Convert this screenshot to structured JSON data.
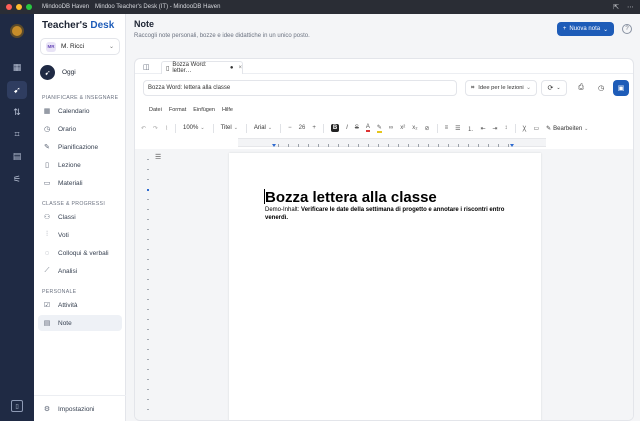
{
  "window": {
    "app_title": "MindooDB Haven",
    "title": "Mindoo Teacher's Desk (IT) - MindooDB Haven",
    "traffic_colors": [
      "#ff5f57",
      "#febc2e",
      "#28c840"
    ]
  },
  "brand": {
    "part1": "Teacher's",
    "part2": "Desk"
  },
  "user": {
    "initials": "MR",
    "name": "M. Ricci"
  },
  "sidebar": {
    "today": "Oggi",
    "section1": "PIANIFICARE & INSEGNARE",
    "items1": [
      "Calendario",
      "Orario",
      "Pianificazione",
      "Lezione",
      "Materiali"
    ],
    "section2": "CLASSE & PROGRESSI",
    "items2": [
      "Classi",
      "Voti",
      "Colloqui & verbali",
      "Analisi"
    ],
    "section3": "PERSONALE",
    "items3": [
      "Attività",
      "Note"
    ],
    "settings": "Impostazioni"
  },
  "header": {
    "title": "Note",
    "subtitle": "Raccogli note personali, bozze e idee didattiche in un unico posto.",
    "new_button": "Nuova nota"
  },
  "editor": {
    "tab_label": "Bozza Word: letter…",
    "tab_dot": "●",
    "name_value": "Bozza Word: lettera alla classe",
    "category": "Idee per le lezioni",
    "menu": [
      "Datei",
      "Format",
      "Einfügen",
      "Hilfe"
    ],
    "toolbar": {
      "zoom": "100%",
      "style": "Titel",
      "font": "Arial",
      "size": "26",
      "mode": "Bearbeiten"
    }
  },
  "document": {
    "heading": "Bozza lettera alla classe",
    "meta_label": "Demo-Inhalt:",
    "meta_text": "Verificare le date della settimana di progetto e annotare i riscontri entro venerdì."
  },
  "colors": {
    "accent": "#1e5cb8",
    "rail": "#1f2a44"
  }
}
